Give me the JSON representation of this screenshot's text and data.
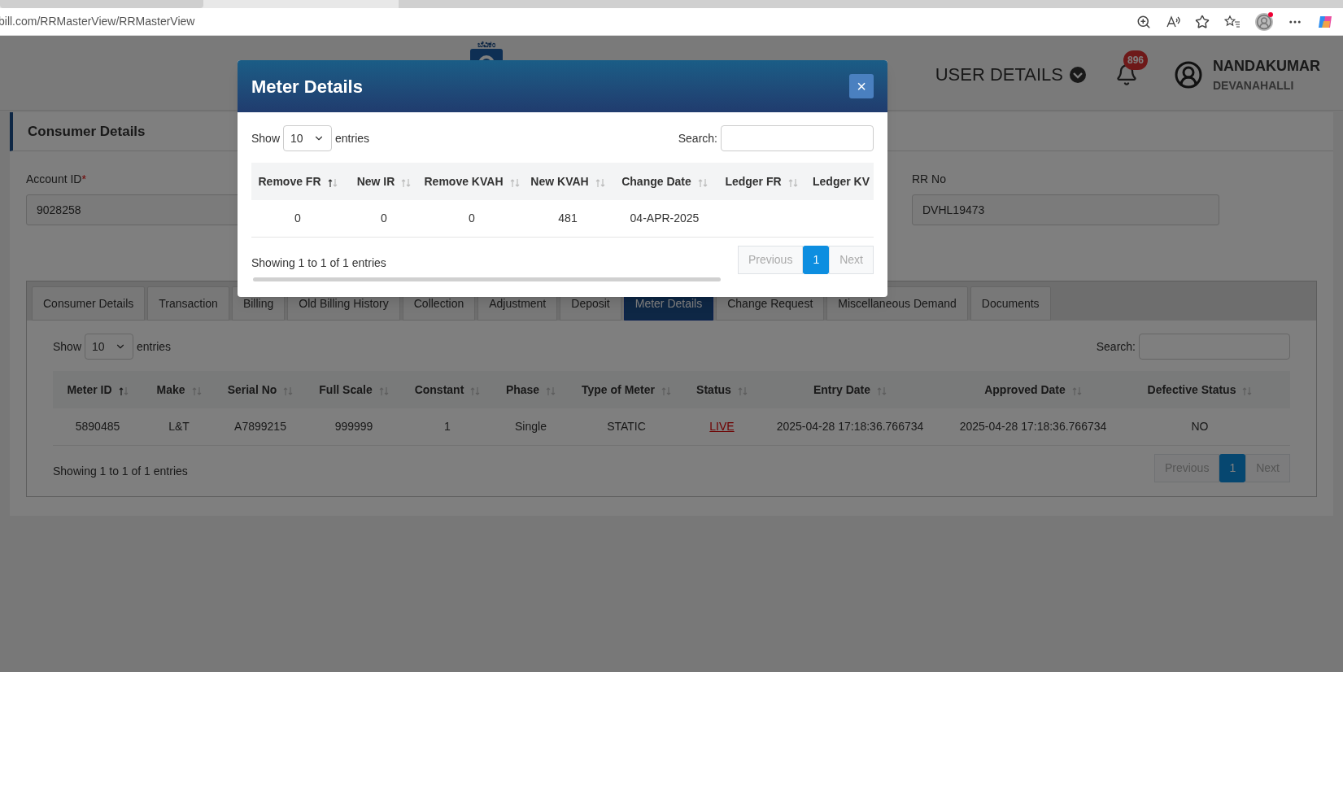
{
  "browser": {
    "url": "bill.com/RRMasterView/RRMasterView"
  },
  "header": {
    "logo_text": "ಬೆವಿಕಂ",
    "user_details": "USER DETAILS",
    "notification_count": "896",
    "user_name": "NANDAKUMAR",
    "user_location": "DEVANAHALLI"
  },
  "consumer_details": {
    "title": "Consumer Details",
    "fields": [
      {
        "label": "Account ID",
        "required_mark": "*",
        "value": "9028258"
      },
      {
        "label": "RR No",
        "value": "DVHL19473"
      }
    ]
  },
  "tabs": [
    {
      "label": "Consumer Details",
      "selected": false
    },
    {
      "label": "Transaction",
      "selected": false
    },
    {
      "label": "Billing",
      "selected": false
    },
    {
      "label": "Old Billing History",
      "selected": false
    },
    {
      "label": "Collection",
      "selected": false
    },
    {
      "label": "Adjustment",
      "selected": false
    },
    {
      "label": "Deposit",
      "selected": false
    },
    {
      "label": "Meter Details",
      "selected": true
    },
    {
      "label": "Change Request",
      "selected": false
    },
    {
      "label": "Miscellaneous Demand",
      "selected": false
    },
    {
      "label": "Documents",
      "selected": false
    }
  ],
  "meter_table": {
    "show": "Show",
    "page_size": "10",
    "entries": "entries",
    "search": "Search:",
    "columns": [
      {
        "label": "Meter ID",
        "sorted": true
      },
      {
        "label": "Make",
        "sorted": false
      },
      {
        "label": "Serial No",
        "sorted": false
      },
      {
        "label": "Full Scale",
        "sorted": false
      },
      {
        "label": "Constant",
        "sorted": false
      },
      {
        "label": "Phase",
        "sorted": false
      },
      {
        "label": "Type of Meter",
        "sorted": false
      },
      {
        "label": "Status",
        "sorted": false,
        "kind": "link"
      },
      {
        "label": "Entry Date",
        "sorted": false
      },
      {
        "label": "Approved Date",
        "sorted": false
      },
      {
        "label": "Defective Status",
        "sorted": false
      }
    ],
    "rows": [
      [
        "5890485",
        "L&T",
        "A7899215",
        "999999",
        "1",
        "Single",
        "STATIC",
        "LIVE",
        "2025-04-28 17:18:36.766734",
        "2025-04-28 17:18:36.766734",
        "NO"
      ]
    ],
    "info": "Showing 1 to 1 of 1 entries",
    "pagination": {
      "previous": {
        "label": "Previous",
        "disabled": true
      },
      "pages": [
        {
          "label": "1",
          "selected": true
        }
      ],
      "next": {
        "label": "Next",
        "disabled": true
      }
    }
  },
  "modal": {
    "title": "Meter Details",
    "close": "×",
    "show": "Show",
    "page_size": "10",
    "entries": "entries",
    "search": "Search:",
    "columns": [
      {
        "label": "Remove FR",
        "sorted": true
      },
      {
        "label": "New IR",
        "sorted": false
      },
      {
        "label": "Remove KVAH",
        "sorted": false
      },
      {
        "label": "New KVAH",
        "sorted": false
      },
      {
        "label": "Change Date",
        "sorted": false
      },
      {
        "label": "Ledger FR",
        "sorted": false
      },
      {
        "label": "Ledger KV"
      }
    ],
    "rows": [
      [
        "0",
        "0",
        "0",
        "481",
        "04-APR-2025"
      ]
    ],
    "info": "Showing 1 to 1 of 1 entries",
    "pagination": {
      "previous": {
        "label": "Previous",
        "disabled": true
      },
      "pages": [
        {
          "label": "1",
          "selected": true
        }
      ],
      "next": {
        "label": "Next",
        "disabled": true
      }
    }
  }
}
